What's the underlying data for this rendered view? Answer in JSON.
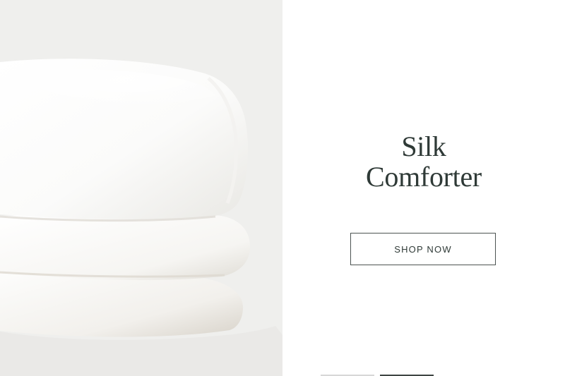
{
  "hero": {
    "image_name": "folded-white-silk-comforter"
  },
  "promo": {
    "title_line_1": "Silk",
    "title_line_2": "Comforter",
    "button_label": "SHOP NOW"
  },
  "carousel": {
    "slides": 2,
    "active_index": 1
  },
  "colors": {
    "image_background": "#efefed",
    "text": "#2f3a37",
    "button_border": "#4c5351",
    "panel_background": "#ffffff"
  }
}
